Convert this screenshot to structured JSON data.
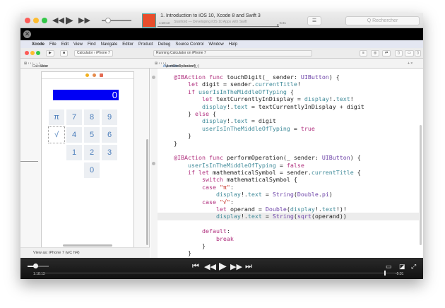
{
  "player": {
    "title": "1. Introduction to iOS 10, Xcode 8 and Swift 3",
    "subtitle": "Stanford — Developing iOS 10 Apps with Swift",
    "elapsed": "1:18:13",
    "remaining": "-5:31",
    "search_placeholder": "Q Rechercher",
    "volume_fraction": 0.2,
    "progress_fraction": 0.94,
    "artwork_label": "Stanford"
  },
  "menubar": {
    "items": [
      "Xcode",
      "File",
      "Edit",
      "View",
      "Find",
      "Navigate",
      "Editor",
      "Product",
      "Debug",
      "Source Control",
      "Window",
      "Help"
    ]
  },
  "xcode": {
    "scheme": "Calculator",
    "device": "iPhone 7",
    "status": "Running Calculator on iPhone 7",
    "ib_jump": [
      "Calculator",
      "View"
    ],
    "editor_jump": [
      "Automatic",
      "ViewController.swift",
      "performOperation(_:)"
    ],
    "view_as": "View as: iPhone 7 (wC hR)"
  },
  "calculator": {
    "display": "0",
    "keys": [
      "π",
      "7",
      "8",
      "9",
      "√",
      "4",
      "5",
      "6",
      "1",
      "2",
      "3",
      "0"
    ]
  },
  "code": [
    [
      [
        "@IBAction ",
        "k"
      ],
      [
        "func ",
        "k"
      ],
      [
        "touchDigit(_ sender: ",
        ""
      ],
      [
        "UIButton",
        "ty"
      ],
      [
        ") {",
        ""
      ]
    ],
    [
      [
        "    let ",
        "k"
      ],
      [
        "digit = sender.",
        ""
      ],
      [
        "currentTitle",
        "p"
      ],
      [
        "!",
        ""
      ]
    ],
    [
      [
        "    if ",
        "k"
      ],
      [
        "userIsInTheMiddleOfTyping",
        "p"
      ],
      [
        " {",
        ""
      ]
    ],
    [
      [
        "        let ",
        "k"
      ],
      [
        "textCurrentlyInDisplay = ",
        ""
      ],
      [
        "display",
        "p"
      ],
      [
        "!.",
        ""
      ],
      [
        "text",
        "p"
      ],
      [
        "!",
        ""
      ]
    ],
    [
      [
        "        display",
        "p"
      ],
      [
        "!.",
        ""
      ],
      [
        "text",
        "p"
      ],
      [
        " = textCurrentlyInDisplay + digit",
        ""
      ]
    ],
    [
      [
        "    } ",
        ""
      ],
      [
        "else",
        "k"
      ],
      [
        " {",
        ""
      ]
    ],
    [
      [
        "        display",
        "p"
      ],
      [
        "!.",
        ""
      ],
      [
        "text",
        "p"
      ],
      [
        " = digit",
        ""
      ]
    ],
    [
      [
        "        userIsInTheMiddleOfTyping",
        "p"
      ],
      [
        " = ",
        ""
      ],
      [
        "true",
        "k"
      ]
    ],
    [
      [
        "    }",
        ""
      ]
    ],
    [
      [
        "}",
        ""
      ]
    ],
    [
      [
        "",
        ""
      ]
    ],
    [
      [
        "@IBAction ",
        "k"
      ],
      [
        "func ",
        "k"
      ],
      [
        "performOperation(_ sender: ",
        ""
      ],
      [
        "UIButton",
        "ty"
      ],
      [
        ") {",
        ""
      ]
    ],
    [
      [
        "    userIsInTheMiddleOfTyping",
        "p"
      ],
      [
        " = ",
        ""
      ],
      [
        "false",
        "k"
      ]
    ],
    [
      [
        "    if let ",
        "k"
      ],
      [
        "mathematicalSymbol = sender.",
        ""
      ],
      [
        "currentTitle",
        "p"
      ],
      [
        " {",
        ""
      ]
    ],
    [
      [
        "        switch ",
        "k"
      ],
      [
        "mathematicalSymbol {",
        ""
      ]
    ],
    [
      [
        "        case ",
        "k"
      ],
      [
        "\"π\"",
        "s"
      ],
      [
        ":",
        ""
      ]
    ],
    [
      [
        "            display",
        "p"
      ],
      [
        "!.",
        ""
      ],
      [
        "text",
        "p"
      ],
      [
        " = ",
        ""
      ],
      [
        "String",
        "ty"
      ],
      [
        "(",
        ""
      ],
      [
        "Double",
        "ty"
      ],
      [
        ".",
        ""
      ],
      [
        "pi",
        "ty"
      ],
      [
        ")",
        ""
      ]
    ],
    [
      [
        "        case ",
        "k"
      ],
      [
        "\"√\"",
        "s"
      ],
      [
        ":",
        ""
      ]
    ],
    [
      [
        "            let ",
        "k"
      ],
      [
        "operand = ",
        ""
      ],
      [
        "Double",
        "ty"
      ],
      [
        "(",
        ""
      ],
      [
        "display",
        "p"
      ],
      [
        "!.",
        ""
      ],
      [
        "text",
        "p"
      ],
      [
        "!)!",
        ""
      ]
    ],
    [
      [
        "            display",
        "p"
      ],
      [
        "!.",
        ""
      ],
      [
        "text",
        "p"
      ],
      [
        " = ",
        ""
      ],
      [
        "String",
        "ty"
      ],
      [
        "(",
        ""
      ],
      [
        "sqrt",
        "ty"
      ],
      [
        "(operand))",
        ""
      ]
    ],
    [
      [
        "",
        ""
      ]
    ],
    [
      [
        "        default",
        "k"
      ],
      [
        ":",
        ""
      ]
    ],
    [
      [
        "            break",
        "k"
      ]
    ],
    [
      [
        "        }",
        ""
      ]
    ],
    [
      [
        "    }",
        ""
      ]
    ],
    [
      [
        "}",
        ""
      ]
    ]
  ],
  "highlighted_line": 19
}
